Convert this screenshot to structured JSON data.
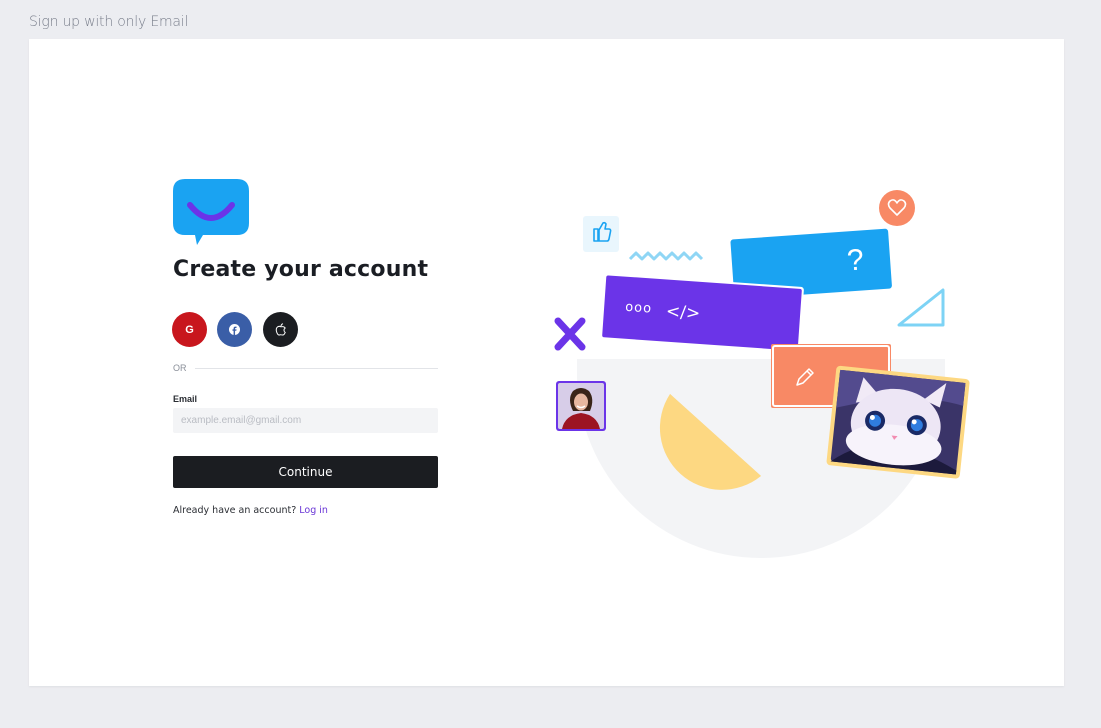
{
  "frame": {
    "label": "Sign up with only Email"
  },
  "form": {
    "title": "Create your account",
    "social": {
      "google_icon": "G",
      "facebook_icon": "f",
      "apple_icon": "apple-icon"
    },
    "divider_text": "OR",
    "email_label": "Email",
    "email_placeholder": "example.email@gmail.com",
    "email_value": "",
    "continue_label": "Continue",
    "login_prompt": "Already have an account?",
    "login_link": "Log in"
  },
  "illustration": {
    "question_mark": "?",
    "code_glyph": "</>",
    "dots": "ooo"
  },
  "colors": {
    "brand_blue": "#1aa3f2",
    "purple": "#6b34e8",
    "coral": "#f88965",
    "yellow": "#fdd882",
    "light_blue": "#7dd3f5"
  }
}
